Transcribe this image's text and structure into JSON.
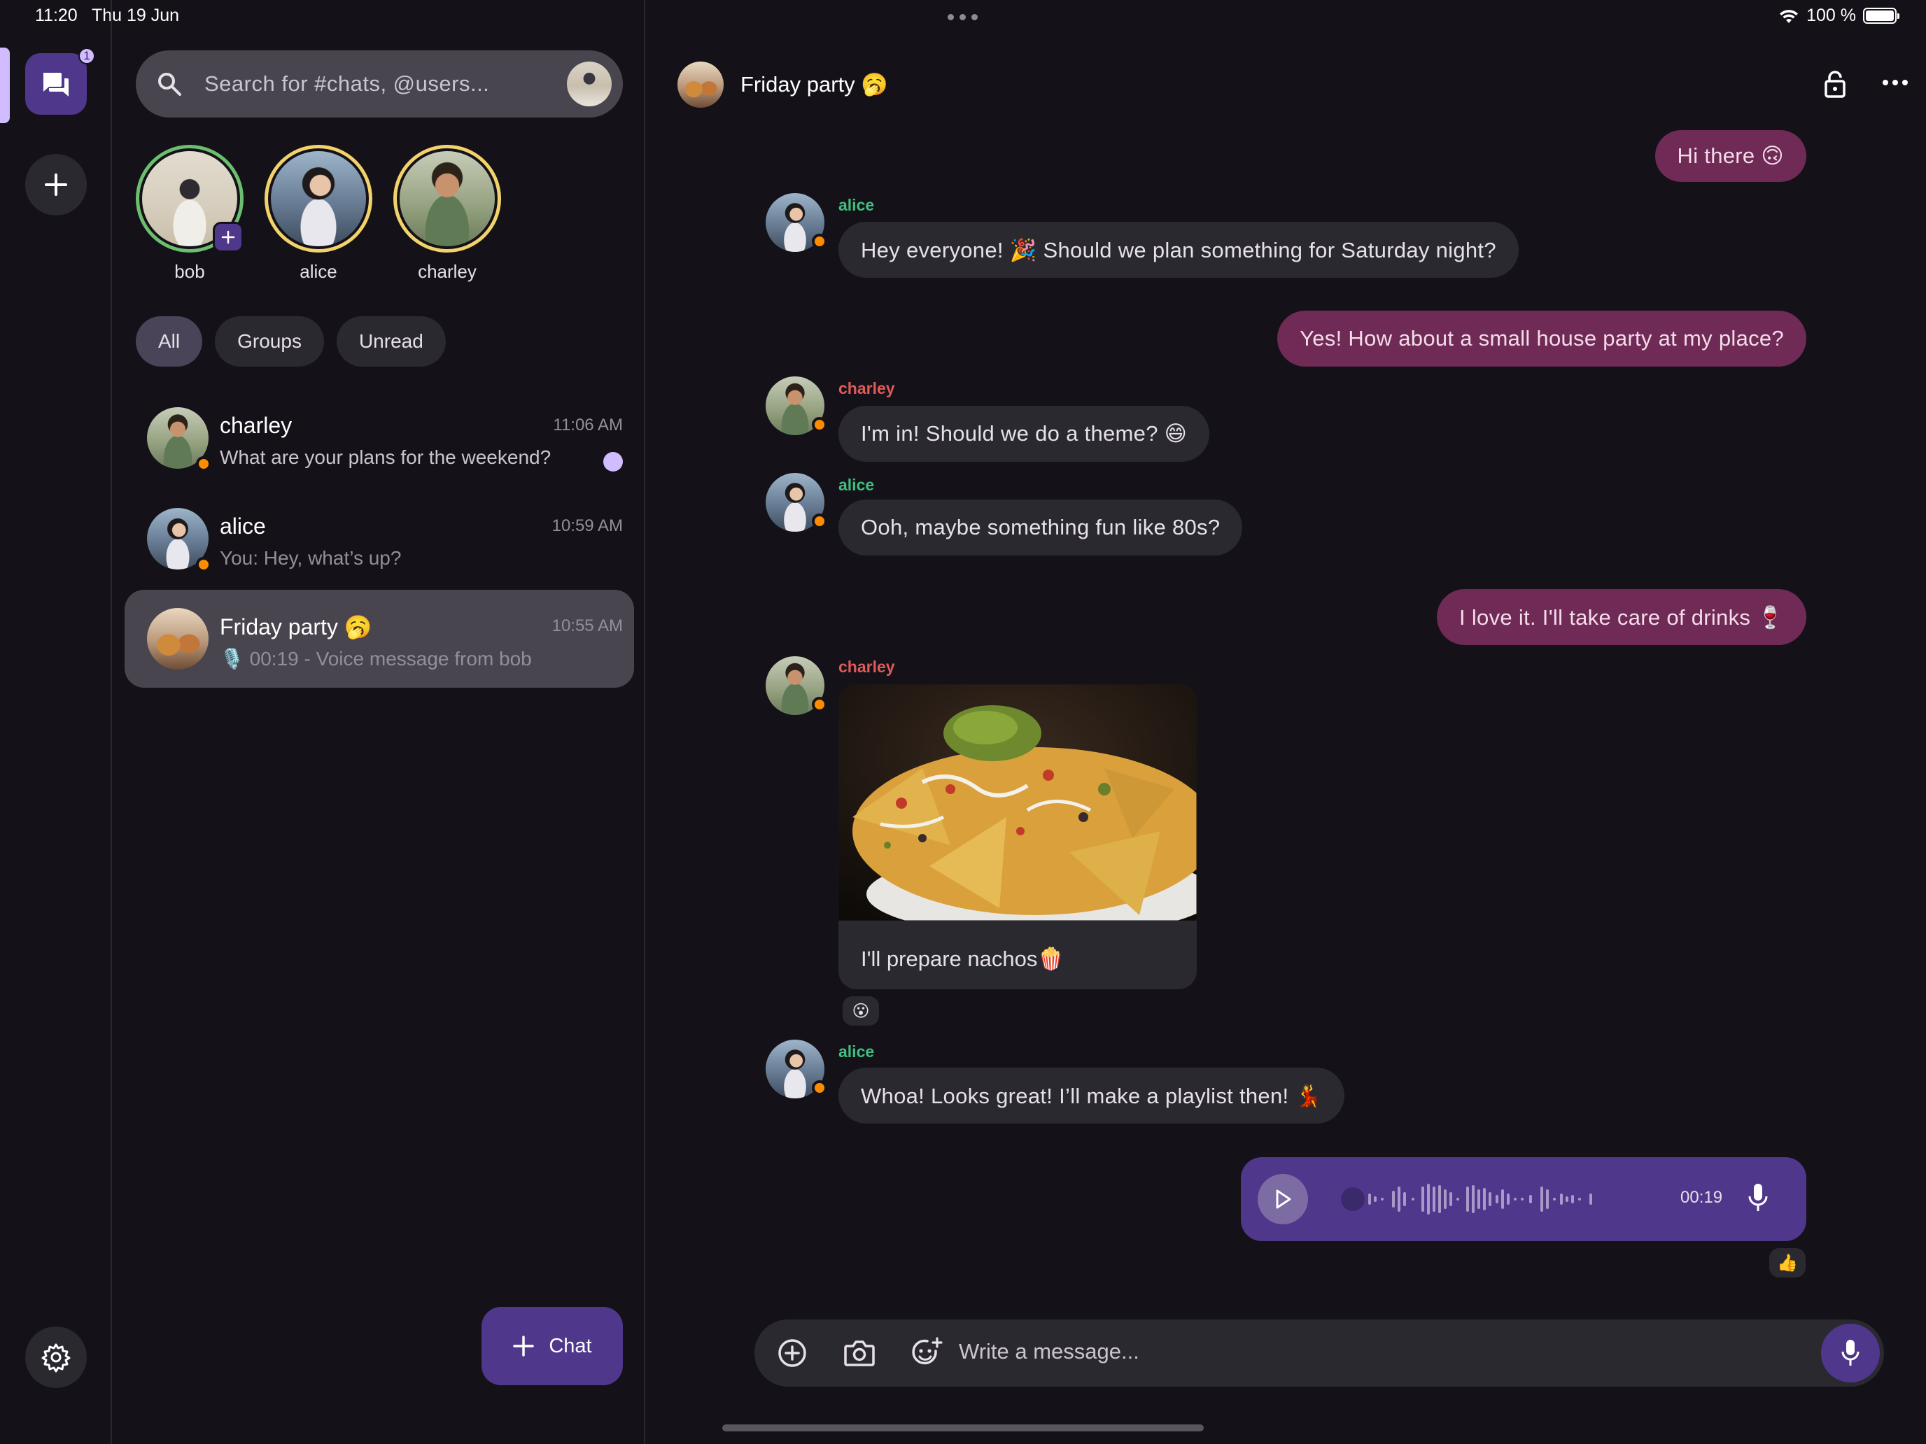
{
  "status_bar": {
    "time": "11:20",
    "date": "Thu 19 Jun",
    "battery": "100 %"
  },
  "rail": {
    "chats_badge": "1"
  },
  "search": {
    "placeholder": "Search for #chats, @users..."
  },
  "stories": [
    {
      "name": "bob"
    },
    {
      "name": "alice"
    },
    {
      "name": "charley"
    }
  ],
  "filters": [
    "All",
    "Groups",
    "Unread"
  ],
  "chats": [
    {
      "name": "charley",
      "time": "11:06 AM",
      "preview": "What are your plans for the weekend?"
    },
    {
      "name": "alice",
      "time": "10:59 AM",
      "preview": "You: Hey, what’s up?"
    },
    {
      "name": "Friday party 🥱",
      "time": "10:55 AM",
      "preview": "🎙️ 00:19 - Voice message from bob"
    }
  ],
  "fab": {
    "label": "Chat"
  },
  "conversation": {
    "title": "Friday party 🥱",
    "messages": [
      {
        "from": "me",
        "text": "Hi there 🙃"
      },
      {
        "from": "alice",
        "text": "Hey everyone! 🎉 Should we plan something for Saturday night?"
      },
      {
        "from": "me",
        "text": "Yes! How about a small house party at my place?"
      },
      {
        "from": "charley",
        "text": "I'm in! Should we do a theme? 😄"
      },
      {
        "from": "alice",
        "text": "Ooh, maybe something fun like 80s?"
      },
      {
        "from": "me",
        "text": "I love it. I'll take care of drinks 🍷"
      },
      {
        "from": "charley",
        "text": "I'll prepare nachos🍿",
        "reaction": "😮"
      },
      {
        "from": "alice",
        "text": "Whoa! Looks great! I’ll make a playlist then! 💃"
      }
    ],
    "voice": {
      "duration": "00:19",
      "reaction": "👍"
    },
    "composer_placeholder": "Write a message..."
  },
  "colors": {
    "accent": "#4f378b",
    "outgoing": "#6f2a55",
    "incoming": "#2b2930",
    "alice": "#3fbf7f",
    "charley": "#e05a5a",
    "online": "#ff8c00"
  }
}
